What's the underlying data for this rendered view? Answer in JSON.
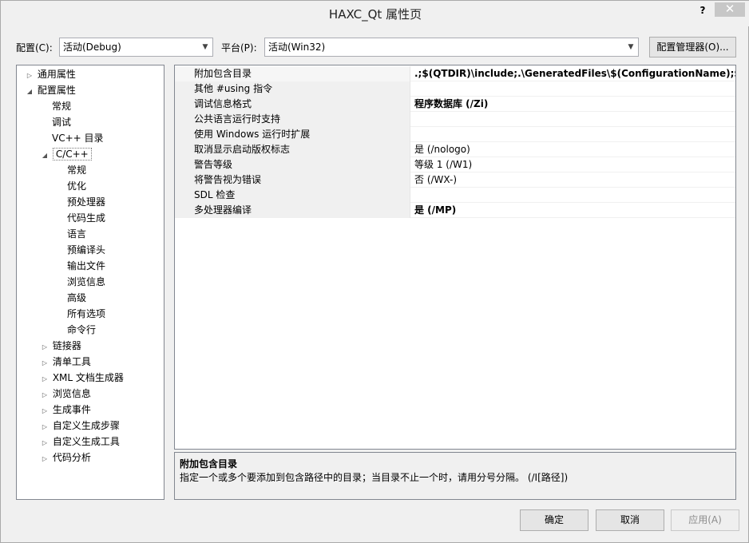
{
  "window": {
    "title": "HAXC_Qt 属性页",
    "help_label": "?",
    "close_label": "✕"
  },
  "config": {
    "config_label": "配置(C):",
    "config_value": "活动(Debug)",
    "platform_label": "平台(P):",
    "platform_value": "活动(Win32)",
    "manager_label": "配置管理器(O)..."
  },
  "tree": {
    "items": [
      {
        "label": "通用属性",
        "toggle": "▷"
      },
      {
        "label": "配置属性",
        "toggle": "◢"
      },
      {
        "label": "常规",
        "toggle": ""
      },
      {
        "label": "调试",
        "toggle": ""
      },
      {
        "label": "VC++ 目录",
        "toggle": ""
      },
      {
        "label": "C/C++",
        "toggle": "◢"
      },
      {
        "label": "常规",
        "toggle": ""
      },
      {
        "label": "优化",
        "toggle": ""
      },
      {
        "label": "预处理器",
        "toggle": ""
      },
      {
        "label": "代码生成",
        "toggle": ""
      },
      {
        "label": "语言",
        "toggle": ""
      },
      {
        "label": "预编译头",
        "toggle": ""
      },
      {
        "label": "输出文件",
        "toggle": ""
      },
      {
        "label": "浏览信息",
        "toggle": ""
      },
      {
        "label": "高级",
        "toggle": ""
      },
      {
        "label": "所有选项",
        "toggle": ""
      },
      {
        "label": "命令行",
        "toggle": ""
      },
      {
        "label": "链接器",
        "toggle": "▷"
      },
      {
        "label": "清单工具",
        "toggle": "▷"
      },
      {
        "label": "XML 文档生成器",
        "toggle": "▷"
      },
      {
        "label": "浏览信息",
        "toggle": "▷"
      },
      {
        "label": "生成事件",
        "toggle": "▷"
      },
      {
        "label": "自定义生成步骤",
        "toggle": "▷"
      },
      {
        "label": "自定义生成工具",
        "toggle": "▷"
      },
      {
        "label": "代码分析",
        "toggle": "▷"
      }
    ]
  },
  "properties": [
    {
      "name": "附加包含目录",
      "value": ".;$(QTDIR)\\include;.\\GeneratedFiles\\$(ConfigurationName);$(QTD",
      "bold": true
    },
    {
      "name": "其他 #using 指令",
      "value": "",
      "bold": false
    },
    {
      "name": "调试信息格式",
      "value": "程序数据库 (/Zi)",
      "bold": true
    },
    {
      "name": "公共语言运行时支持",
      "value": "",
      "bold": false
    },
    {
      "name": "使用 Windows 运行时扩展",
      "value": "",
      "bold": false
    },
    {
      "name": "取消显示启动版权标志",
      "value": "是 (/nologo)",
      "bold": false
    },
    {
      "name": "警告等级",
      "value": "等级 1 (/W1)",
      "bold": false
    },
    {
      "name": "将警告视为错误",
      "value": "否 (/WX-)",
      "bold": false
    },
    {
      "name": "SDL 检查",
      "value": "",
      "bold": false
    },
    {
      "name": "多处理器编译",
      "value": "是 (/MP)",
      "bold": true
    }
  ],
  "description": {
    "title": "附加包含目录",
    "text": "指定一个或多个要添加到包含路径中的目录；当目录不止一个时，请用分号分隔。     (/I[路径])"
  },
  "buttons": {
    "ok": "确定",
    "cancel": "取消",
    "apply": "应用(A)"
  }
}
